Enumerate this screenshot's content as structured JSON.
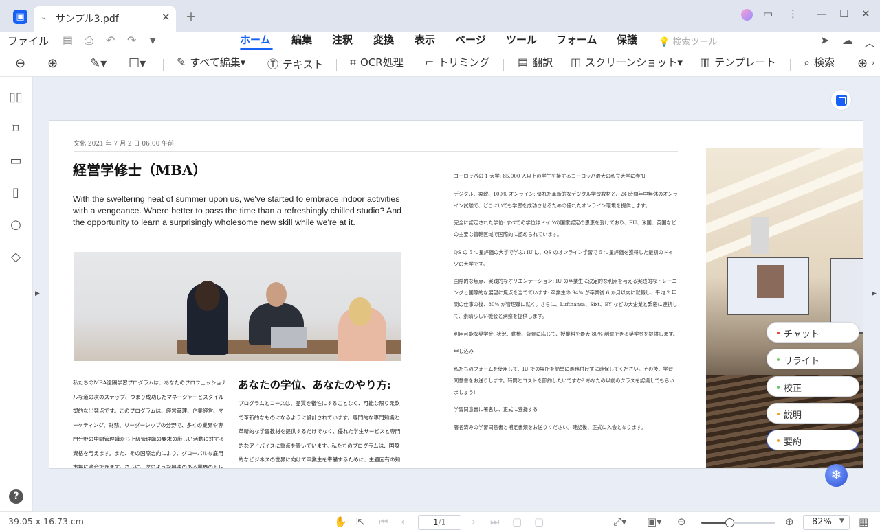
{
  "titlebar": {
    "tab_chevron": "⌄",
    "tab_name": "サンプル3.pdf",
    "tab_close": "✕",
    "new_tab": "+",
    "icons": [
      "avatar-icon",
      "comment-icon",
      "more-icon",
      "minimize-icon",
      "maximize-icon",
      "close-window-icon"
    ]
  },
  "menubar": {
    "file": "ファイル",
    "tabs": [
      "ホーム",
      "編集",
      "注釈",
      "変換",
      "表示",
      "ページ",
      "ツール",
      "フォーム",
      "保護"
    ],
    "active_tab": "ホーム",
    "search_tools": "検索ツール"
  },
  "toolbar": {
    "edit_all": "すべて編集",
    "text": "テキスト",
    "ocr": "OCR処理",
    "crop": "トリミング",
    "translate": "翻訳",
    "screenshot": "スクリーンショット",
    "template": "テンプレート",
    "search": "検索"
  },
  "sidebar": {
    "items": [
      "thumbnail-icon",
      "bookmark-icon",
      "comment-icon",
      "attachment-icon",
      "search-icon",
      "layers-icon"
    ],
    "help": "?"
  },
  "document": {
    "date": "文化 2021 年 7 月 2 日 06:00 午前",
    "title": "経営学修士（MBA）",
    "lead": "With the sweltering heat of summer upon us, we've started to embrace indoor activities with a vengeance. Where better to pass the time than a refreshingly chilled studio? And the opportunity to learn a surprisingly wholesome new skill while we're at it.",
    "col_a": "私たちのMBA遠隔学習プログラムは、あなたのプロフェッショナルな道の次のステップ、つまり成功したマネージャーとスタイル塑的な出発点です。このプログラムは、経営管理、企業経営、マーケティング、財務、リーダーシップの分野で、多くの業界や専門分野の中間管理職から上級管理職の要求の厳しい活動に対する資格を与えます。また、その国際志向により、グローバルな雇用市場に適合できます。さらに、次のような興味のある業界のトレンドや",
    "col_b_title": "あなたの学位、あなたのやり方:",
    "col_b": "プログラムとコースは、品質を犠牲にすることなく、可能な限り柔軟で革新的なものになるように設計されています。専門的な専門知識と革新的な学習教材を提供するだけでなく、優れた学生サービスと専門的なアドバイスに重点を置いています。私たちのプログラムは、国際的なビジネスの世界に向けて卒業生を準備するために、主題固有の知識とソフトスキ",
    "col_c": [
      "ヨーロッパの 1 大学: 85,000 人以上の学生を擁するヨーロッパ最大の私立大学に参加",
      "デジタル、柔軟、100% オンライン: 優れた革新的なデジタル学習教材と、24 時間年中無休のオンライン試験で、どこにいても学習を成功させるための優れたオンライン環境を提供します。",
      "完全に認定された学位: すべての学位はドイツの国家認定の恩恵を受けており、EU、米国、英国などの主要な管轄区域で国際的に認められています。",
      "QS の 5 つ星評価の大学で学ぶ: IU は、QS のオンライン学習で 5 つ星評価を獲得した最初のドイツの大学です。",
      "国際的な焦点、実践的なオリエンテーション: IU の卒業生に決定的な利点を与える実践的なトレーニングと国際的な展望に焦点を当てています: 卒業生の 94% が卒業後 6 か月以内に就職し、平均 2 年間の仕事の後、80% が管理職に就く。さらに、Lufthansa、Sixt、EY などの大企業と緊密に連携して、素晴らしい機会と洞察を提供します。",
      "利用可能な奨学金: 状況、動機、背景に応じて、授業料を最大 80% 削減できる奨学金を提供します。",
      "申し込み",
      "私たちのフォームを使用して、IU での場所を簡単に義務付けずに確保してください。その後、学習同意書をお送りします。時間とコストを節約したいですか? あなたの以前のクラスを認識してもらいましょう!",
      "学習同意書に署名し、正式に登録する",
      "署名済みの学習同意書と補足書類をお送りください。確認後、正式に入会となります。"
    ]
  },
  "ai_menu": [
    {
      "label": "チャット",
      "dot": "#e8452f"
    },
    {
      "label": "リライト",
      "dot": "#6ac46a"
    },
    {
      "label": "校正",
      "dot": "#6ac46a"
    },
    {
      "label": "説明",
      "dot": "#f0a020"
    },
    {
      "label": "要約",
      "dot": "#f0a020"
    }
  ],
  "statusbar": {
    "dimensions": "39.05 x 16.73 cm",
    "page_current": "1",
    "page_total": "/1",
    "zoom": "82%",
    "zoom_fraction": 0.38
  },
  "colors": {
    "accent": "#1762f5",
    "active_chip_border": "#3f67e8"
  }
}
